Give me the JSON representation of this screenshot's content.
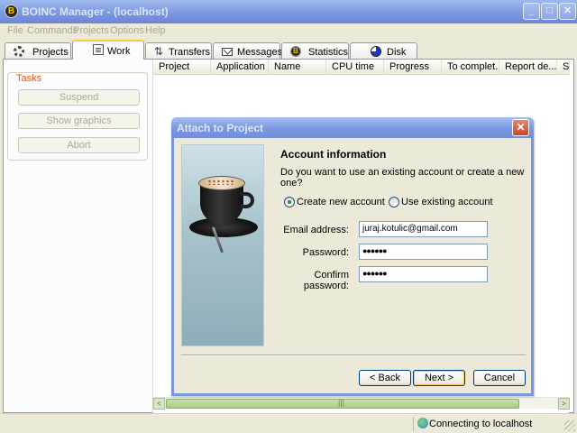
{
  "window": {
    "title": "BOINC Manager - (localhost)",
    "app_icon": "boinc-icon",
    "min_glyph": "_",
    "max_glyph": "□",
    "close_glyph": "✕"
  },
  "menu": {
    "file": "File",
    "commands": "Commands",
    "projects": "Projects",
    "options": "Options",
    "help": "Help"
  },
  "tabs": [
    {
      "label": "Projects",
      "icon": "gear-icon"
    },
    {
      "label": "Work",
      "icon": "document-icon",
      "active": true
    },
    {
      "label": "Transfers",
      "icon": "transfers-icon"
    },
    {
      "label": "Messages",
      "icon": "envelope-icon"
    },
    {
      "label": "Statistics",
      "icon": "boinc-statistics-icon"
    },
    {
      "label": "Disk",
      "icon": "pie-disk-icon"
    }
  ],
  "tasks": {
    "legend": "Tasks",
    "buttons": [
      "Suspend",
      "Show graphics",
      "Abort"
    ]
  },
  "columns": [
    "Project",
    "Application",
    "Name",
    "CPU time",
    "Progress",
    "To complet...",
    "Report de...",
    "St"
  ],
  "scrollbar": {
    "left_arrow": "<",
    "right_arrow": ">",
    "thumb_grip": "|||"
  },
  "status": {
    "text": "Connecting to localhost",
    "icon": "globe-icon"
  },
  "dialog": {
    "title": "Attach to Project",
    "close_glyph": "✕",
    "heading": "Account information",
    "question": "Do you want to use an existing account or create a new one?",
    "radio_create": "Create new account",
    "radio_existing": "Use existing account",
    "selected": "create",
    "email_label": "Email address:",
    "email_value": "juraj.kotulic@gmail.com",
    "password_label": "Password:",
    "password_value": "●●●●●●",
    "confirm_label": "Confirm password:",
    "confirm_value": "●●●●●●",
    "back_label": "< Back",
    "next_label": "Next >",
    "cancel_label": "Cancel"
  },
  "colors": {
    "title_inactive": "#7a96df",
    "tab_highlight": "#ffc83c",
    "legend": "#e2540e",
    "dialog_bg": "#ece9d8"
  }
}
